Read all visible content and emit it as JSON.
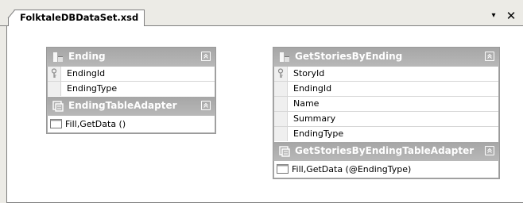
{
  "tab": {
    "title": "FolktaleDBDataSet.xsd",
    "dropdown_glyph": "▾",
    "close_glyph": "✕"
  },
  "tables": [
    {
      "name": "Ending",
      "icon": "table-icon",
      "columns": [
        {
          "name": "EndingId",
          "key": true
        },
        {
          "name": "EndingType",
          "key": false
        }
      ],
      "adapter": {
        "name": "EndingTableAdapter",
        "icon": "table-adapter-icon",
        "methods": [
          "Fill,GetData ()"
        ]
      }
    },
    {
      "name": "GetStoriesByEnding",
      "icon": "table-icon",
      "columns": [
        {
          "name": "StoryId",
          "key": true
        },
        {
          "name": "EndingId",
          "key": false
        },
        {
          "name": "Name",
          "key": false
        },
        {
          "name": "Summary",
          "key": false
        },
        {
          "name": "EndingType",
          "key": false
        }
      ],
      "adapter": {
        "name": "GetStoriesByEndingTableAdapter",
        "icon": "table-adapter-icon",
        "methods": [
          "Fill,GetData (@EndingType)"
        ]
      }
    }
  ],
  "colors": {
    "header_gray": "#a9a9a9",
    "canvas": "#ffffff",
    "chrome": "#ecebe6"
  }
}
